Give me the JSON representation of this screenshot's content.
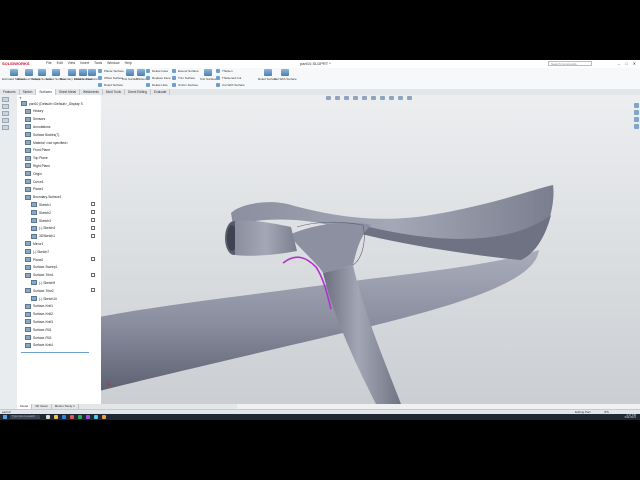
{
  "app": {
    "logo": "SOLIDWORKS",
    "menu": [
      "File",
      "Edit",
      "View",
      "Insert",
      "Tools",
      "Window",
      "Help"
    ],
    "document_title": "part10.SLDPRT *",
    "search_placeholder": "Search Commands",
    "window_controls": [
      "–",
      "□",
      "✕"
    ]
  },
  "ribbon": {
    "large_buttons": [
      "Extruded Surface",
      "Revolved Surface",
      "Swept Surface",
      "Lofted Surface",
      "Boundary Surface",
      "Filled Surface",
      "Freeform",
      "Trim Surface",
      "Extend Surface",
      "Knit Surface",
      "Untrim Surface",
      "Thicken",
      "Ruled Surface",
      "Cut With Surface"
    ],
    "small_buttons": [
      "Planar Surface",
      "Offset Surface",
      "Ruled Surface",
      "Delete Face",
      "Replace Face",
      "Delete Hole",
      "Extend Surface",
      "Trim Surface",
      "Untrim Surface",
      "Thicken",
      "Thickened Cut",
      "Cut With Surface"
    ]
  },
  "command_tabs": [
    "Features",
    "Sketch",
    "Surfaces",
    "Sheet Metal",
    "Weldments",
    "Mold Tools",
    "Direct Editing",
    "Evaluate"
  ],
  "active_tab": "Surfaces",
  "feature_tree": {
    "filter_label": "▼",
    "items": [
      "part10 (Default<<Default>_Display S",
      "History",
      "Sensors",
      "Annotations",
      "Surface Bodies(7)",
      "Material <not specified>",
      "Front Plane",
      "Top Plane",
      "Right Plane",
      "Origin",
      "Curve1",
      "Plane1",
      "Boundary-Surface1",
      "Sketch1",
      "Sketch2",
      "Sketch3",
      "(-) Sketch4",
      "3DSketch1",
      "Mirror1",
      "(-) Sketch7",
      "Plane2",
      "Surface-Sweep1",
      "Surface-Trim1",
      "(-) Sketch9",
      "Surface-Trim2",
      "(-) Sketch10",
      "Surface-Knit1",
      "Surface-Knit2",
      "Surface-Knit3",
      "Surface-Fill1",
      "Surface-Fill2",
      "Surface-Knit4"
    ]
  },
  "bottom_tabs": [
    "Model",
    "3D Views",
    "Motion Study 1"
  ],
  "status": {
    "left": "part10",
    "mode": "Editing Part",
    "units": "IPS"
  },
  "taskbar": {
    "search_placeholder": "Type here to search",
    "time": "4:17 PM",
    "date": "6/11/2021"
  },
  "colors": {
    "surface": "#8f93a3",
    "surface_dark": "#5b5f6e",
    "highlight_edge": "#b033c8",
    "viewport_top": "#eceef0",
    "viewport_bottom": "#cbced2"
  }
}
